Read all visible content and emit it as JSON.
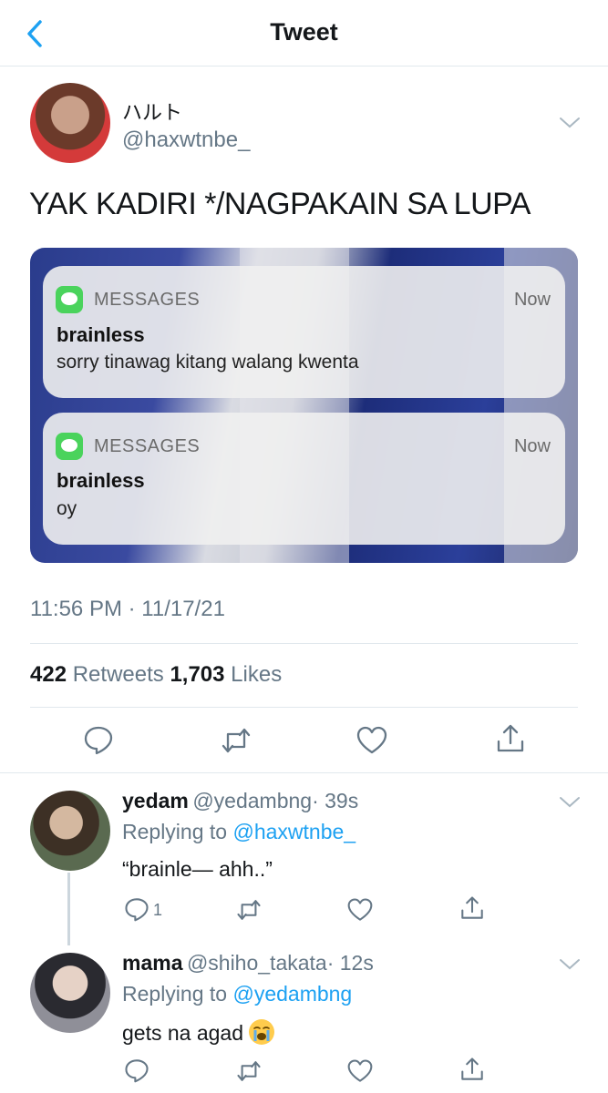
{
  "header": {
    "title": "Tweet"
  },
  "tweet": {
    "name": "ハルト",
    "handle": "@haxwtnbe_",
    "text": "YAK KADIRI */NAGPAKAIN SA LUPA",
    "media": {
      "notifications": [
        {
          "app": "MESSAGES",
          "time": "Now",
          "sender": "brainless",
          "body": "sorry tinawag kitang walang kwenta"
        },
        {
          "app": "MESSAGES",
          "time": "Now",
          "sender": "brainless",
          "body": "oy"
        }
      ]
    },
    "timestamp": "11:56 PM · 11/17/21",
    "retweets_count": "422",
    "retweets_label": "Retweets",
    "likes_count": "1,703",
    "likes_label": "Likes"
  },
  "replies": [
    {
      "name": "yedam",
      "handle": "@yedambng",
      "time": "· 39s",
      "replying_prefix": "Replying to",
      "replying_to": "@haxwtnbe_",
      "text": "“brainle— ahh..”",
      "reply_count": "1"
    },
    {
      "name": "mama",
      "handle": "@shiho_takata",
      "time": "· 12s",
      "replying_prefix": "Replying to",
      "replying_to": "@yedambng",
      "text": "gets na agad",
      "emoji": "loudly-crying-face"
    }
  ],
  "colors": {
    "accent": "#1da1f2",
    "muted": "#657786",
    "text": "#14171a",
    "divider": "#e1e8ed"
  },
  "icons": [
    "back-chevron-icon",
    "chevron-down-icon",
    "reply-icon",
    "retweet-icon",
    "like-icon",
    "share-icon",
    "messages-app-icon"
  ]
}
